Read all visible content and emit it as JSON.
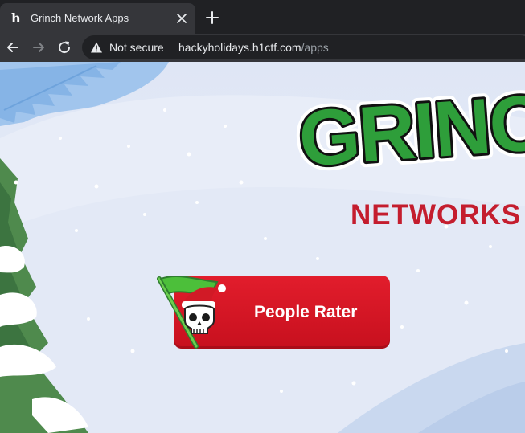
{
  "browser": {
    "tab": {
      "title": "Grinch Network Apps",
      "favicon": "h1-favicon"
    },
    "address_bar": {
      "security_label": "Not secure",
      "url_host": "hackyholidays.h1ctf.com",
      "url_path": "/apps"
    }
  },
  "page": {
    "logo": {
      "word_top": "GRINCH",
      "word_bottom": "NETWORKS"
    },
    "apps": [
      {
        "label": "People Rater",
        "icon": "skull-santa-hat-flag-icon"
      }
    ]
  },
  "colors": {
    "tab_bar": "#202124",
    "toolbar": "#35363a",
    "button_red": "#e21d2c",
    "logo_green": "#2e9e3a",
    "logo_red": "#c41d2e"
  }
}
